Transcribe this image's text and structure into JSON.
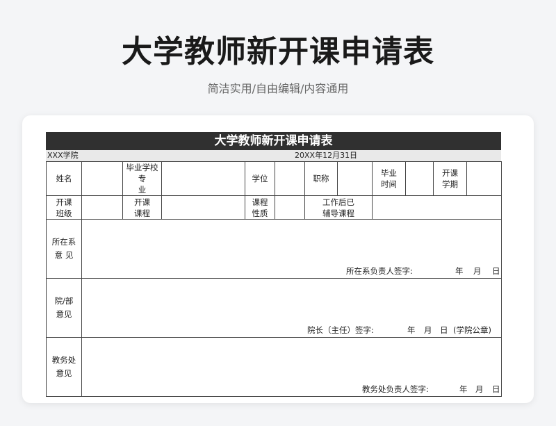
{
  "page": {
    "title": "大学教师新开课申请表",
    "subtitle": "简洁实用/自由编辑/内容通用"
  },
  "sheet": {
    "title": "大学教师新开课申请表",
    "department": "XXX学院",
    "date": "20XX年12月31日",
    "row1": {
      "name_label": "姓名",
      "school_major_label_1": "毕业学校",
      "school_major_label_2": "专 业",
      "degree_label": "学位",
      "title_label": "职称",
      "grad_time_label_1": "毕业",
      "grad_time_label_2": "时间",
      "semester_label_1": "开课",
      "semester_label_2": "学期"
    },
    "row2": {
      "class_label_1": "开课",
      "class_label_2": "班级",
      "course_label_1": "开课",
      "course_label_2": "课程",
      "nature_label_1": "课程",
      "nature_label_2": "性质",
      "tutored_label_1": "工作后已",
      "tutored_label_2": "辅导课程"
    },
    "dept_opinion": {
      "label_1": "所在系",
      "label_2": "意 见",
      "sign": "所在系负责人签字:",
      "y": "年",
      "m": "月",
      "d": "日"
    },
    "college_opinion": {
      "label_1": "院/部",
      "label_2": "意见",
      "sign": "院长（主任）签字:",
      "y": "年",
      "m": "月",
      "d": "日",
      "seal": "(学院公章)"
    },
    "office_opinion": {
      "label_1": "教务处",
      "label_2": "意见",
      "sign": "教务处负责人签字:",
      "y": "年",
      "m": "月",
      "d": "日"
    }
  }
}
